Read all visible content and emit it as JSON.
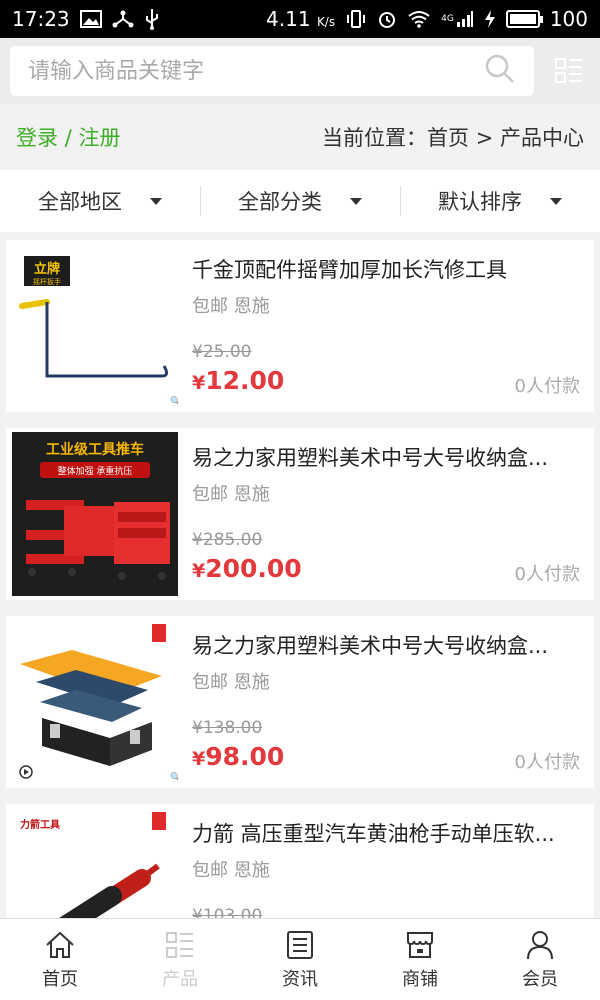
{
  "status_bar": {
    "time": "17:23",
    "speed": "4.11",
    "speed_unit": "K/s",
    "network": "4G",
    "battery": "100"
  },
  "search": {
    "placeholder": "请输入商品关键字"
  },
  "header": {
    "login": "登录",
    "separator": "/",
    "register": "注册",
    "location": "当前位置：首页 > 产品中心"
  },
  "filters": [
    {
      "label": "全部地区"
    },
    {
      "label": "全部分类"
    },
    {
      "label": "默认排序"
    }
  ],
  "products": [
    {
      "title": "千金顶配件摇臂加厚加长汽修工具",
      "tags": "包邮 恩施",
      "old_price": "¥25.00",
      "price_symbol": "¥",
      "price": "12.00",
      "sold": "0人付款",
      "brand": "立牌",
      "brand_sub": "摇杆扳手"
    },
    {
      "title": "易之力家用塑料美术中号大号收纳盒...",
      "tags": "包邮 恩施",
      "old_price": "¥285.00",
      "price_symbol": "¥",
      "price": "200.00",
      "sold": "0人付款",
      "banner": "工业级工具推车",
      "banner_sub": "整体加强 承重抗压"
    },
    {
      "title": "易之力家用塑料美术中号大号收纳盒...",
      "tags": "包邮 恩施",
      "old_price": "¥138.00",
      "price_symbol": "¥",
      "price": "98.00",
      "sold": "0人付款"
    },
    {
      "title": "力箭 高压重型汽车黄油枪手动单压软...",
      "tags": "包邮 恩施",
      "old_price": "¥103.00",
      "price_symbol": "¥",
      "price": "",
      "sold": "",
      "brand": "力箭工具"
    }
  ],
  "nav": [
    {
      "label": "首页",
      "icon": "home-icon"
    },
    {
      "label": "产品",
      "icon": "grid-list-icon"
    },
    {
      "label": "资讯",
      "icon": "news-icon"
    },
    {
      "label": "商铺",
      "icon": "shop-icon"
    },
    {
      "label": "会员",
      "icon": "user-icon"
    }
  ],
  "colors": {
    "accent_green": "#3fae2a",
    "price_red": "#e4393c"
  }
}
